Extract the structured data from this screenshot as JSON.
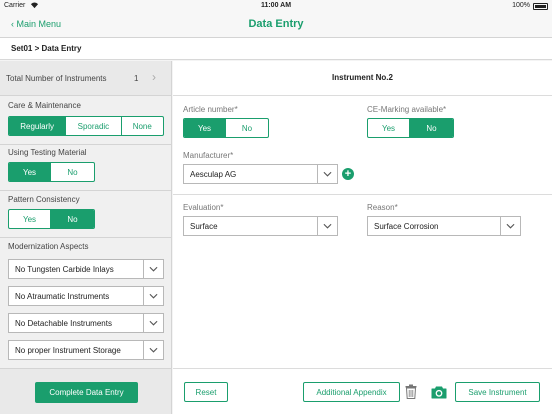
{
  "status_bar": {
    "carrier": "Carrier",
    "time": "11:00 AM",
    "battery": "100%"
  },
  "nav": {
    "back_label": "Main Menu",
    "title": "Data Entry"
  },
  "breadcrumb": "Set01 > Data Entry",
  "sidebar": {
    "total_label": "Total Number of Instruments",
    "total_count": "1",
    "care": {
      "label": "Care & Maintenance",
      "options": [
        "Regularly",
        "Sporadic",
        "None"
      ],
      "selected": "Regularly"
    },
    "testing": {
      "label": "Using Testing Material",
      "options": [
        "Yes",
        "No"
      ],
      "selected": "Yes"
    },
    "pattern": {
      "label": "Pattern Consistency",
      "options": [
        "Yes",
        "No"
      ],
      "selected": "No"
    },
    "modernization": {
      "label": "Modernization Aspects",
      "items": [
        "No Tungsten Carbide Inlays",
        "No Atraumatic Instruments",
        "No Detachable Instruments",
        "No proper Instrument Storage"
      ]
    },
    "complete_button": "Complete Data Entry"
  },
  "main": {
    "title": "Instrument No.2",
    "article": {
      "label": "Article number*",
      "options": [
        "Yes",
        "No"
      ],
      "selected": "Yes"
    },
    "ce_marking": {
      "label": "CE-Marking available*",
      "options": [
        "Yes",
        "No"
      ],
      "selected": "No"
    },
    "manufacturer": {
      "label": "Manufacturer*",
      "value": "Aesculap AG"
    },
    "evaluation": {
      "label": "Evaluation*",
      "value": "Surface"
    },
    "reason": {
      "label": "Reason*",
      "value": "Surface Corrosion"
    },
    "footer": {
      "reset": "Reset",
      "additional_appendix": "Additional Appendix",
      "save": "Save Instrument"
    }
  },
  "colors": {
    "accent": "#1a9e6d"
  },
  "icons": [
    "wifi-icon",
    "battery-icon",
    "chevron-left-icon",
    "chevron-right-icon",
    "chevron-down-icon",
    "plus-icon",
    "trash-icon",
    "camera-icon"
  ]
}
